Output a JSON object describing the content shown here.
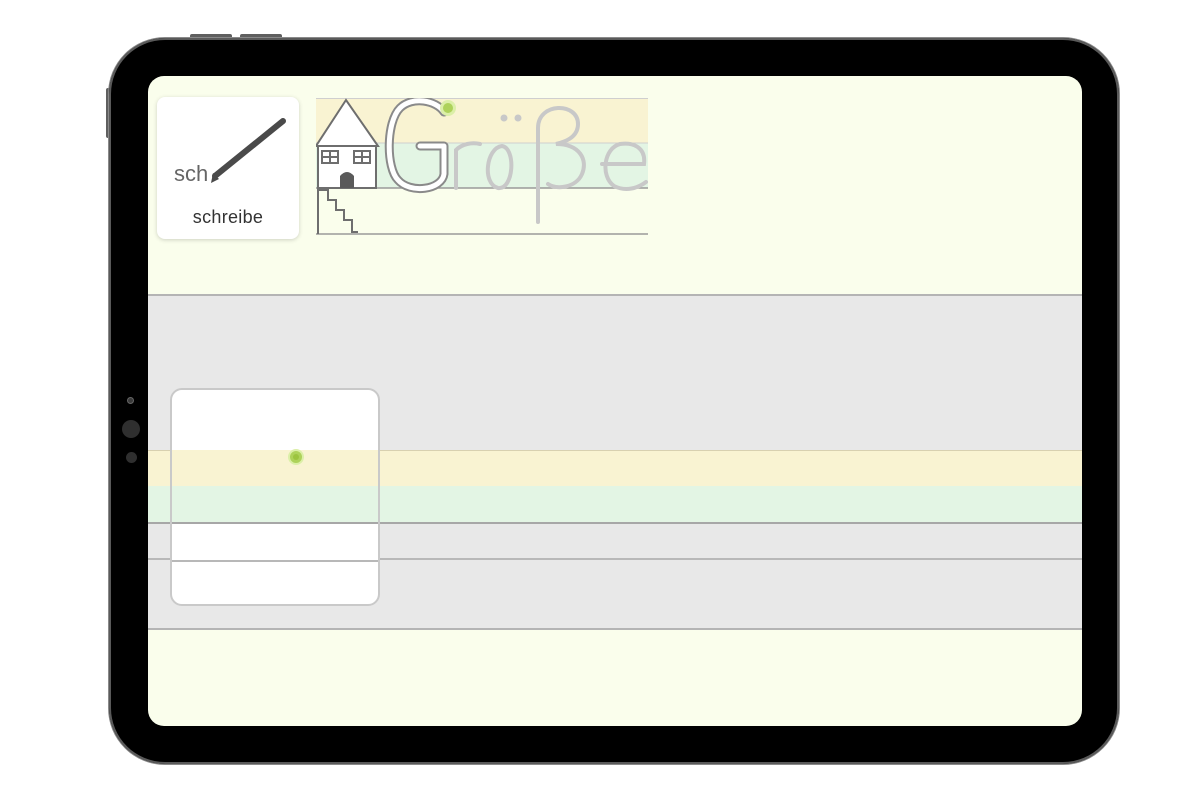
{
  "task": {
    "sound": "sch",
    "label": "schreibe",
    "icon": "pencil-icon"
  },
  "word": {
    "text": "Größe",
    "traced_letters": "G",
    "remaining_letters": "röße",
    "icon": "house-icon"
  },
  "colors": {
    "screen_background": "#fafeec",
    "writing_area": "#e8e8e8",
    "upper_band": "#f9f3d2",
    "middle_band": "#e3f5e4",
    "start_point": "#aed25a",
    "word_outline": "#8a8a8a",
    "word_ghost": "#c8c8c8"
  },
  "writing": {
    "start_point": "start-dot-icon"
  }
}
